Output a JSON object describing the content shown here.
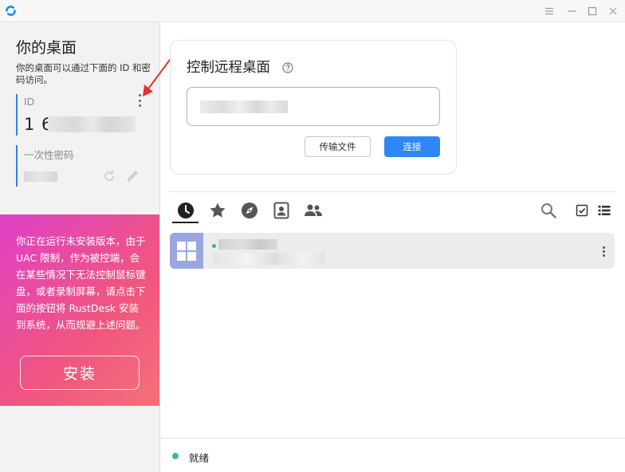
{
  "titlebar": {
    "icons": [
      "app-logo-icon",
      "menu-icon",
      "minimize-icon",
      "maximize-icon",
      "close-icon"
    ]
  },
  "left": {
    "title": "你的桌面",
    "description": "你的桌面可以通过下面的 ID 和密码访问。",
    "id_label": "ID",
    "id_value": "1 6",
    "password_label": "一次性密码",
    "warning": "你正在运行未安装版本，由于 UAC 限制，作为被控端，会在某些情况下无法控制鼠标键盘，或者录制屏幕，请点击下面的按钮将 RustDesk 安装到系统，从而规避上述问题。",
    "install_label": "安装"
  },
  "connect": {
    "title": "控制远程桌面",
    "transfer_label": "传输文件",
    "connect_label": "连接"
  },
  "tabs": [
    {
      "name": "recent",
      "icon": "clock-icon",
      "active": true
    },
    {
      "name": "favorites",
      "icon": "star-icon",
      "active": false
    },
    {
      "name": "discovered",
      "icon": "compass-icon",
      "active": false
    },
    {
      "name": "address-book",
      "icon": "contact-card-icon",
      "active": false
    },
    {
      "name": "group",
      "icon": "people-icon",
      "active": false
    }
  ],
  "status": {
    "text": "就绪"
  },
  "colors": {
    "accent": "#2f87f5",
    "warning_gradient_start": "#e040c7",
    "warning_gradient_end": "#f5707a",
    "status_ok": "#3ab9a5",
    "online": "#3bb86b"
  }
}
